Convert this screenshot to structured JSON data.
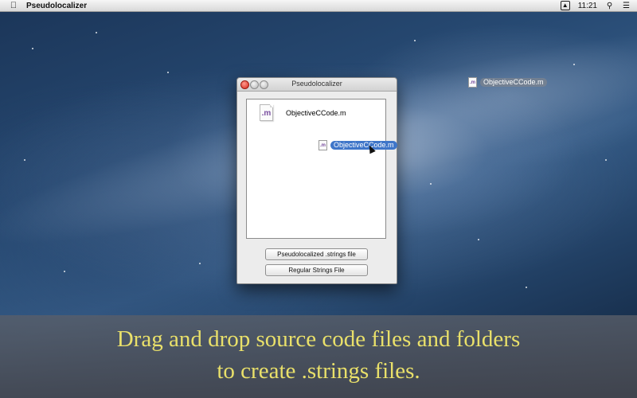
{
  "menubar": {
    "app_name": "Pseudolocalizer",
    "clock": "11:21",
    "icons": [
      "apple-icon",
      "display-mirroring-icon",
      "spotlight-icon",
      "notification-center-icon"
    ]
  },
  "window": {
    "title": "Pseudolocalizer",
    "file_name": "ObjectiveCCode.m",
    "dragging_file_name": "ObjectiveCCode.m",
    "buttons": {
      "pseudolocalized": "Pseudolocalized .strings file",
      "regular": "Regular Strings File"
    }
  },
  "desktop": {
    "file_name": "ObjectiveCCode.m"
  },
  "caption": {
    "line1": "Drag and drop source code files and folders",
    "line2": "to create .strings files."
  },
  "colors": {
    "caption_text": "#e9e06a",
    "selection_blue": "#3f76c9",
    "close_button": "#d6261a"
  }
}
